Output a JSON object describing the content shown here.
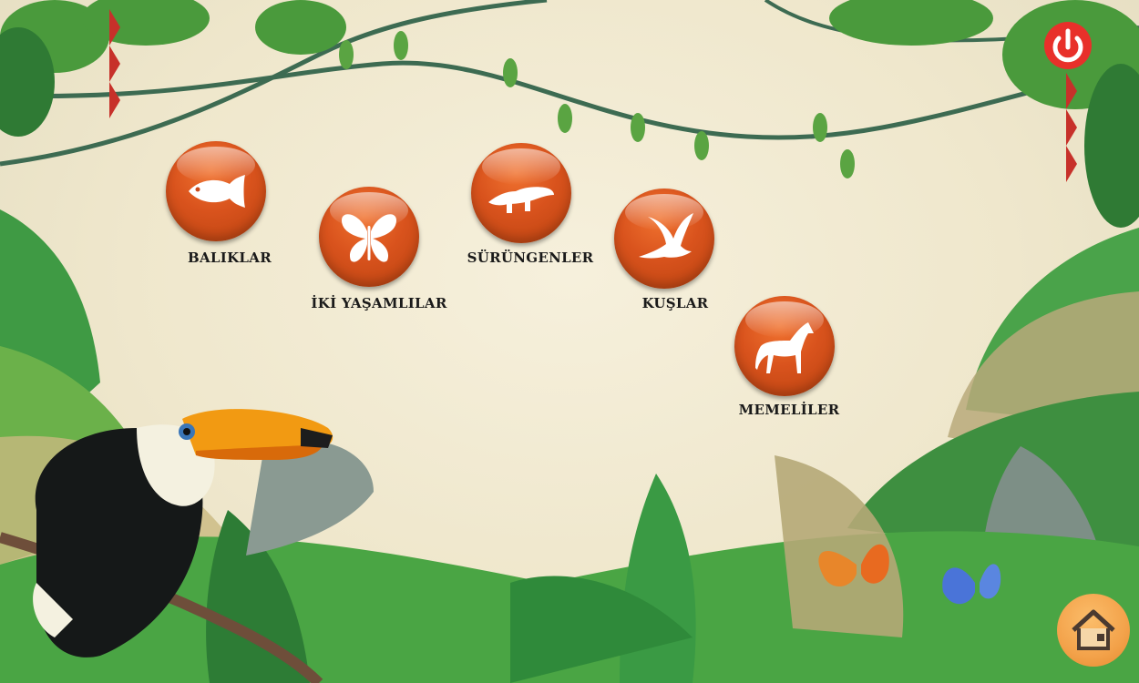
{
  "categories": [
    {
      "id": "fish",
      "label": "BALIKLAR",
      "icon": "fish-icon"
    },
    {
      "id": "amphibians",
      "label": "İKİ YAŞAMLILAR",
      "icon": "butterfly-icon"
    },
    {
      "id": "reptiles",
      "label": "SÜRÜNGENLER",
      "icon": "crocodile-icon"
    },
    {
      "id": "birds",
      "label": "KUŞLAR",
      "icon": "bird-icon"
    },
    {
      "id": "mammals",
      "label": "MEMELİLER",
      "icon": "horse-icon"
    }
  ],
  "controls": {
    "power_icon": "power-icon",
    "home_icon": "home-icon"
  },
  "colors": {
    "button_orange": "#d9531d",
    "power_red": "#e8302a",
    "home_orange": "#f3a24a",
    "background": "#f3ecd6",
    "leaf_green": "#2f8f3a"
  }
}
